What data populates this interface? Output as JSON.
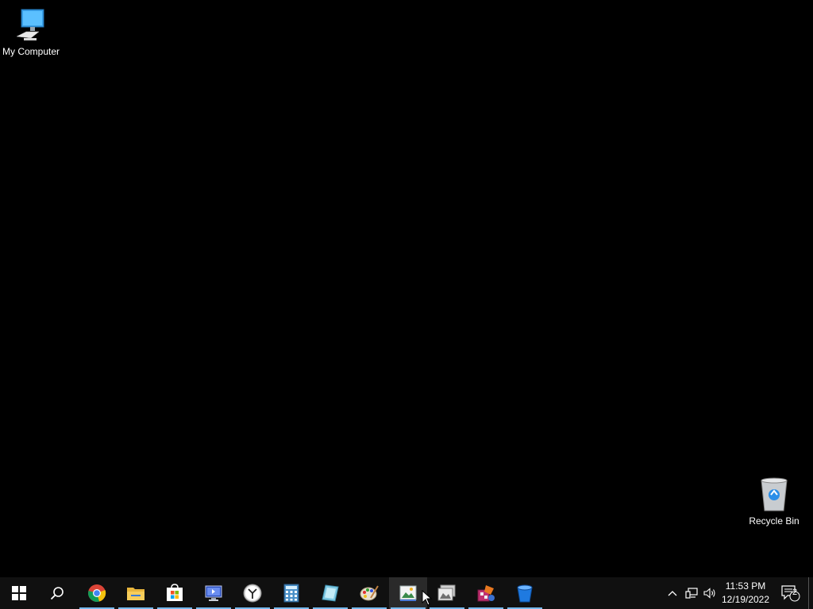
{
  "desktop": {
    "icons": [
      {
        "label": "My Computer",
        "icon": "computer-icon"
      },
      {
        "label": "Recycle Bin",
        "icon": "recycle-bin-icon"
      }
    ]
  },
  "taskbar": {
    "apps": [
      {
        "name": "chrome",
        "icon": "chrome-icon",
        "running": true
      },
      {
        "name": "file-explorer",
        "icon": "folder-icon",
        "running": true
      },
      {
        "name": "microsoft-store",
        "icon": "store-icon",
        "running": true
      },
      {
        "name": "remote-desktop",
        "icon": "remote-desktop-icon",
        "running": true
      },
      {
        "name": "clock",
        "icon": "clock-icon",
        "running": true
      },
      {
        "name": "calculator",
        "icon": "calculator-icon",
        "running": true
      },
      {
        "name": "notebook",
        "icon": "notebook-icon",
        "running": true
      },
      {
        "name": "paint",
        "icon": "paint-icon",
        "running": true
      },
      {
        "name": "image-viewer",
        "icon": "image-viewer-icon",
        "running": true,
        "focused": true
      },
      {
        "name": "photo-gallery",
        "icon": "photo-gallery-icon",
        "running": true
      },
      {
        "name": "media-toolkit",
        "icon": "media-toolkit-icon",
        "running": true
      },
      {
        "name": "bucket-app",
        "icon": "bucket-icon",
        "running": true
      }
    ],
    "tray": {
      "time": "11:53 PM",
      "date": "12/19/2022",
      "notification_count": "2"
    }
  },
  "colors": {
    "desktop_background": "#000000",
    "taskbar_background": "#101010",
    "running_indicator": "#76b9ed"
  }
}
